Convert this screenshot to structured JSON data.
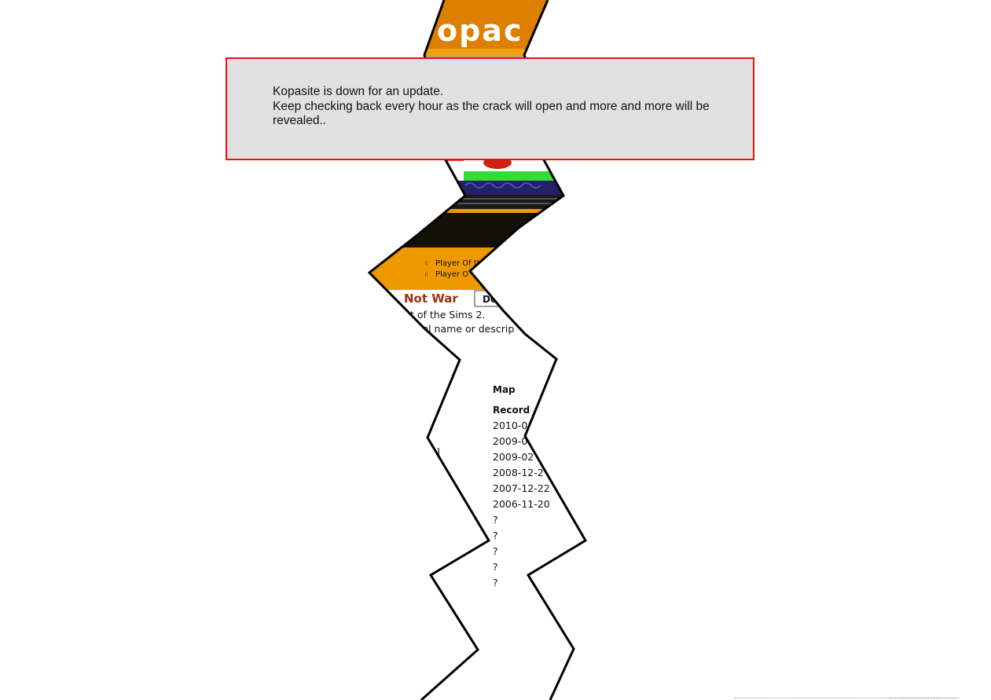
{
  "notice": {
    "line1": "Kopasite is down for an update.",
    "line2": "Keep checking back every hour as the crack will open and more and more will be revealed.."
  },
  "crack": {
    "logo_text": "opac",
    "nav_items": [
      "Player Of th",
      "Player O"
    ],
    "heading": "Not War",
    "button_label": "Do",
    "desc_line1": "t of the Sims 2.",
    "desc_line2": "vel name or descrip",
    "table_header_map": "Map",
    "table_header_record": "Record",
    "bracket": "]",
    "dates": [
      "2010-0",
      "2009-0",
      "2009-02",
      "2008-12-2",
      "2007-12-22",
      "2006-11-20",
      "?",
      "?",
      "?",
      "?",
      "?"
    ]
  },
  "colors": {
    "notice_bg": "#e1e1e1",
    "notice_border": "#ee1111",
    "brand_orange": "#ee9900",
    "heading_red": "#993311"
  }
}
